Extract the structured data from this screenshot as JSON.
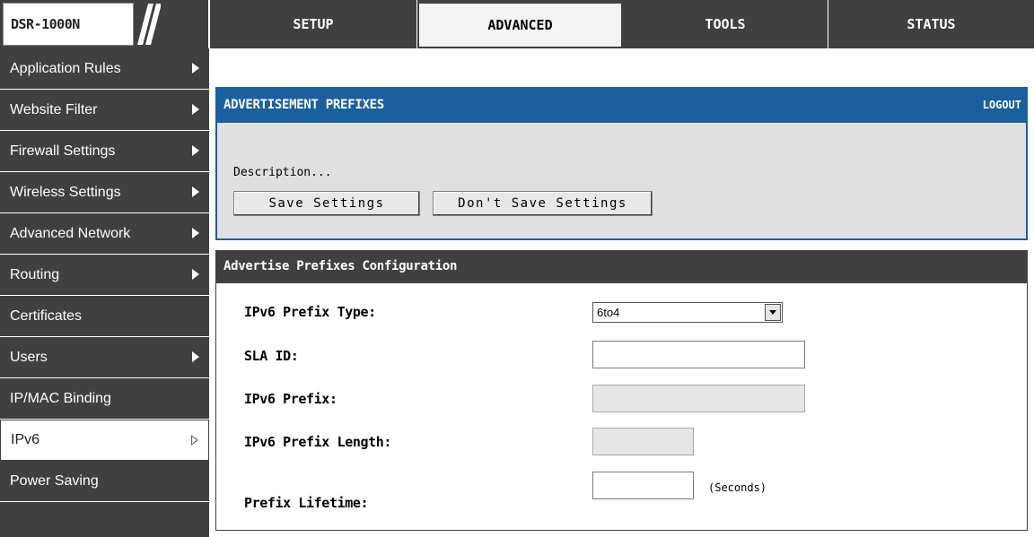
{
  "header": {
    "device_model": "DSR-1000N",
    "tabs": [
      {
        "label": "SETUP"
      },
      {
        "label": "ADVANCED"
      },
      {
        "label": "TOOLS"
      },
      {
        "label": "STATUS"
      }
    ],
    "active_tab": "ADVANCED"
  },
  "sidebar": {
    "items": [
      {
        "label": "Application Rules",
        "arrow": "filled"
      },
      {
        "label": "Website Filter",
        "arrow": "filled"
      },
      {
        "label": "Firewall Settings",
        "arrow": "filled"
      },
      {
        "label": "Wireless Settings",
        "arrow": "filled"
      },
      {
        "label": "Advanced Network",
        "arrow": "filled"
      },
      {
        "label": "Routing",
        "arrow": "filled"
      },
      {
        "label": "Certificates",
        "arrow": "none"
      },
      {
        "label": "Users",
        "arrow": "filled"
      },
      {
        "label": "IP/MAC Binding",
        "arrow": "none"
      },
      {
        "label": "IPv6",
        "arrow": "hollow"
      },
      {
        "label": "Power Saving",
        "arrow": "none"
      }
    ],
    "active_item": "IPv6"
  },
  "panel": {
    "title": "ADVERTISEMENT PREFIXES",
    "logout_label": "LOGOUT",
    "description": "Description...",
    "save_label": "Save Settings",
    "dont_save_label": "Don't Save Settings"
  },
  "config": {
    "title": "Advertise Prefixes Configuration",
    "prefix_type_label": "IPv6 Prefix Type:",
    "prefix_type_value": "6to4",
    "sla_id_label": "SLA ID:",
    "sla_id_value": "",
    "prefix_label": "IPv6 Prefix:",
    "prefix_value": "",
    "prefix_length_label": "IPv6 Prefix Length:",
    "prefix_length_value": "",
    "lifetime_label": "Prefix Lifetime:",
    "lifetime_value": "",
    "lifetime_unit": "(Seconds)"
  },
  "colors": {
    "dark": "#404040",
    "accent_blue": "#1a5fa0",
    "panel_gray": "#e0e0e0"
  }
}
